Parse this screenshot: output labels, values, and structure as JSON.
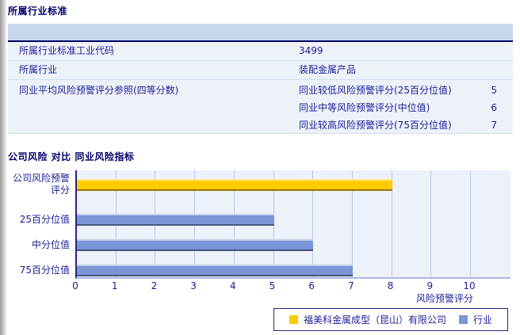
{
  "accent_color": "#00006b",
  "section1": {
    "title": "所属行业标准",
    "rows": [
      {
        "label": "所属行业标准工业代码",
        "value": "3499"
      },
      {
        "label": "所属行业",
        "value": "装配金属产品"
      },
      {
        "label": "同业平均风险预警评分参照(四等分数)",
        "subrows": [
          {
            "label": "同业较低风险预警评分(25百分位值)",
            "value": "5"
          },
          {
            "label": "同业中等风险预警评分(中位值)",
            "value": "6"
          },
          {
            "label": "同业较高风险预警评分(75百分位值)",
            "value": "7"
          }
        ]
      }
    ]
  },
  "section2": {
    "title": "公司风险 对比 同业风险指标",
    "chart_data": {
      "type": "bar",
      "orientation": "horizontal",
      "categories": [
        "公司风险预警评分",
        "25百分位值",
        "中分位值",
        "75百分位值"
      ],
      "series": [
        {
          "name": "福美科金属成型（昆山）有限公司",
          "color": "#ffcc00",
          "values": [
            8,
            null,
            null,
            null
          ]
        },
        {
          "name": "行业",
          "color": "#7b95d6",
          "values": [
            null,
            5,
            6,
            7
          ]
        }
      ],
      "xlabel": "风险预警评分",
      "xlim": [
        0,
        10
      ],
      "xticks": [
        0,
        1,
        2,
        3,
        4,
        5,
        6,
        7,
        8,
        9,
        10
      ],
      "grid": true,
      "plot_bg": "#edf1f9",
      "legend_position": "bottom-right"
    }
  }
}
